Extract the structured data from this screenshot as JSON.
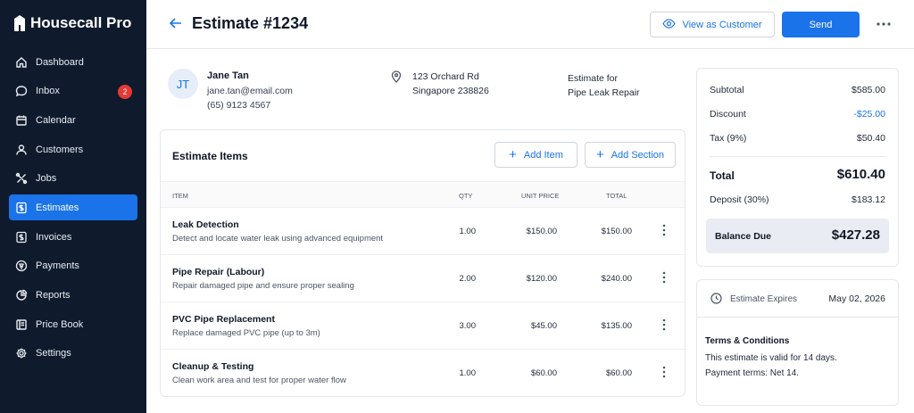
{
  "app": {
    "brand": "Housecall Pro"
  },
  "sidebar": {
    "items": [
      {
        "label": "Dashboard",
        "icon": "home-icon"
      },
      {
        "label": "Inbox",
        "icon": "chat-bubble-icon",
        "badge": "2"
      },
      {
        "label": "Calendar",
        "icon": "calendar-icon"
      },
      {
        "label": "Customers",
        "icon": "person-icon"
      },
      {
        "label": "Jobs",
        "icon": "tools-icon"
      },
      {
        "label": "Estimates",
        "icon": "dollar-doc-icon",
        "active": true
      },
      {
        "label": "Invoices",
        "icon": "invoice-icon"
      },
      {
        "label": "Payments",
        "icon": "payment-icon"
      },
      {
        "label": "Reports",
        "icon": "reports-icon"
      },
      {
        "label": "Price Book",
        "icon": "book-icon"
      },
      {
        "label": "Settings",
        "icon": "gear-icon"
      }
    ]
  },
  "header": {
    "title": "Estimate #1234",
    "view_label": "View as Customer",
    "send_label": "Send",
    "more_icon": "ellipsis-icon"
  },
  "customer": {
    "initials": "JT",
    "name": "Jane Tan",
    "email": "jane.tan@email.com",
    "phone": "(65) 9123 4567",
    "address_line1": "123 Orchard Rd",
    "address_line2": "Singapore 238826",
    "estimate_for_label": "Estimate for",
    "estimate_for_value": "Pipe Leak Repair"
  },
  "items": {
    "title": "Estimate Items",
    "add_item_label": "Add Item",
    "add_section_label": "Add Section",
    "columns": {
      "item": "ITEM",
      "qty": "QTY",
      "unit_price": "UNIT PRICE",
      "total": "TOTAL"
    },
    "rows": [
      {
        "name": "Leak Detection",
        "desc": "Detect and locate water leak using advanced equipment",
        "qty": "1.00",
        "unit": "$150.00",
        "total": "$150.00"
      },
      {
        "name": "Pipe Repair (Labour)",
        "desc": "Repair damaged pipe and ensure proper sealing",
        "qty": "2.00",
        "unit": "$120.00",
        "total": "$240.00"
      },
      {
        "name": "PVC Pipe Replacement",
        "desc": "Replace damaged PVC pipe (up to 3m)",
        "qty": "3.00",
        "unit": "$45.00",
        "total": "$135.00"
      },
      {
        "name": "Cleanup & Testing",
        "desc": "Clean work area and test for proper water flow",
        "qty": "1.00",
        "unit": "$60.00",
        "total": "$60.00"
      }
    ]
  },
  "summary": {
    "subtotal_label": "Subtotal",
    "subtotal": "$585.00",
    "discount_label": "Discount",
    "discount": "-$25.00",
    "tax_label": "Tax (9%)",
    "tax": "$50.40",
    "total_label": "Total",
    "total": "$610.40",
    "deposit_label": "Deposit (30%)",
    "deposit": "$183.12",
    "balance_label": "Balance Due",
    "balance": "$427.28"
  },
  "expiry": {
    "label": "Estimate Expires",
    "date": "May 02, 2026",
    "terms_title": "Terms & Conditions",
    "terms_line1": "This estimate is valid for 14 days.",
    "terms_line2": "Payment terms: Net 14."
  },
  "colors": {
    "accent": "#1a73e8",
    "sidebar_bg": "#0f1b2d",
    "badge": "#e53935",
    "discount": "#1a73e8"
  }
}
